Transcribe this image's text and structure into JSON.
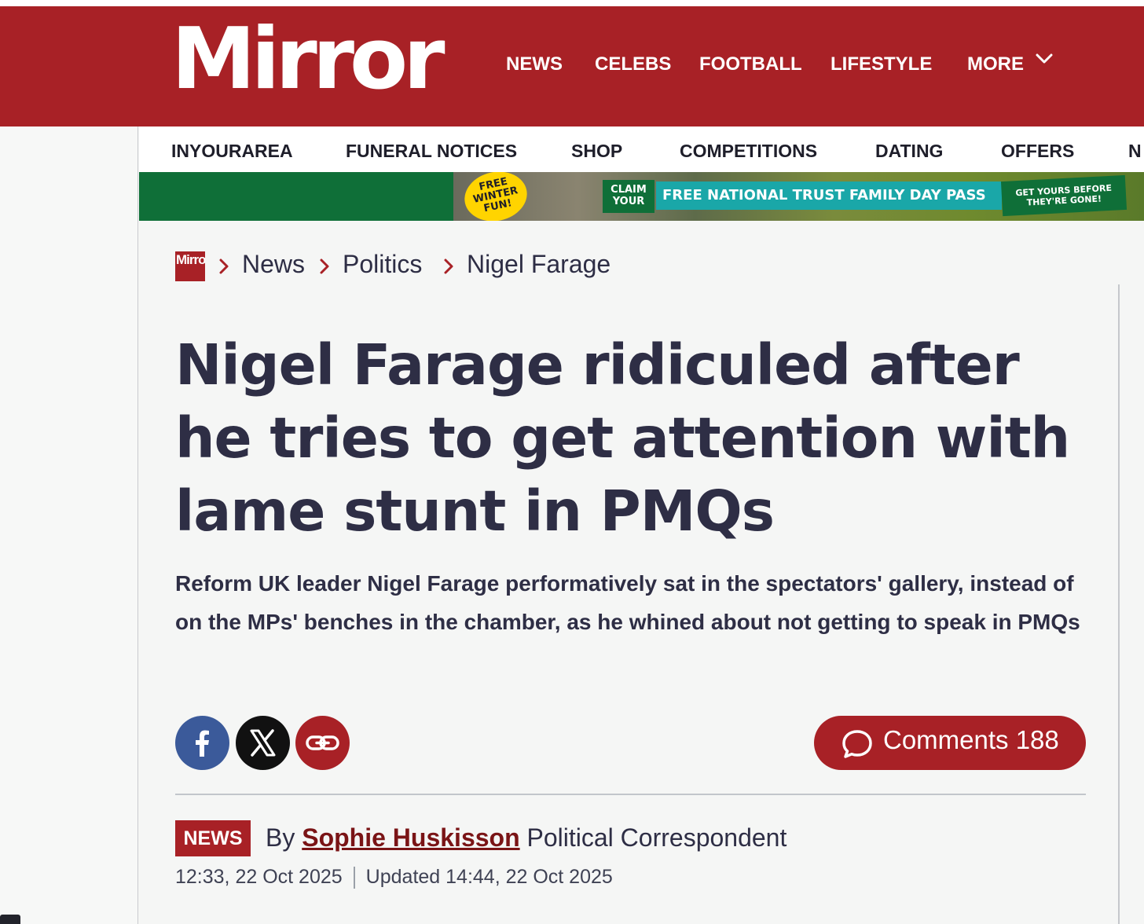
{
  "site": {
    "logo_text": "Mirror",
    "brand_color": "#a82126"
  },
  "main_nav": [
    "NEWS",
    "CELEBS",
    "FOOTBALL",
    "LIFESTYLE",
    "MORE"
  ],
  "sub_nav": [
    "INYOURAREA",
    "FUNERAL NOTICES",
    "SHOP",
    "COMPETITIONS",
    "DATING",
    "OFFERS",
    "N"
  ],
  "promo": {
    "badge": "FREE WINTER FUN!",
    "claim": "CLAIM YOUR",
    "main": "FREE NATIONAL TRUST FAMILY DAY PASS",
    "cta": "GET YOURS BEFORE THEY'RE GONE!"
  },
  "breadcrumb": {
    "logo_text": "Mirror",
    "items": [
      "News",
      "Politics",
      "Nigel Farage"
    ]
  },
  "article": {
    "headline": "Nigel Farage ridiculed after he tries to get attention with lame stunt in PMQs",
    "standfirst": "Reform UK leader Nigel Farage performatively sat in the spectators' gallery, instead of on the MPs' benches in the chamber, as he whined about not getting to speak in PMQs",
    "comments_label": "Comments 188",
    "tag": "NEWS",
    "by": "By",
    "author": "Sophie Huskisson",
    "role": "Political Correspondent",
    "published": "12:33, 22 Oct 2025",
    "updated": "Updated 14:44, 22 Oct 2025"
  },
  "icons": {
    "share": [
      "facebook-icon",
      "x-icon",
      "link-icon"
    ],
    "comments": "speech-bubble-icon",
    "more": "chevron-down-icon",
    "breadcrumb_sep": "chevron-right-icon"
  },
  "colors": {
    "facebook": "#3b5a9a",
    "x": "#111111",
    "link": "#a82126",
    "text": "#2e2e45"
  }
}
